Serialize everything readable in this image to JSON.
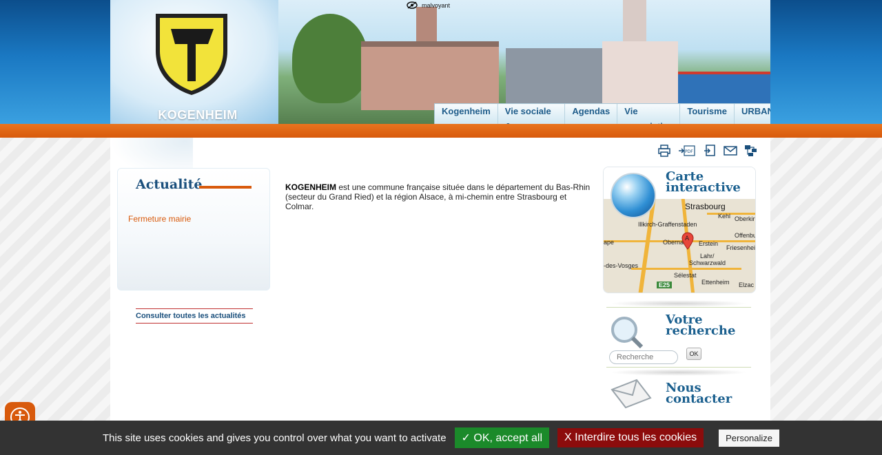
{
  "header": {
    "site_name": "KOGENHEIM",
    "accessibility_link": "malvoyant"
  },
  "nav": {
    "items": [
      {
        "label": "Kogenheim"
      },
      {
        "label": "Vie sociale & économique"
      },
      {
        "label": "Agendas"
      },
      {
        "label": "Vie associative"
      },
      {
        "label": "Tourisme"
      },
      {
        "label": "URBANISME"
      }
    ]
  },
  "tools": [
    "print-icon",
    "pdf-icon",
    "export-icon",
    "mail-icon",
    "sitemap-icon"
  ],
  "news": {
    "title": "Actualité",
    "items": [
      "Fermeture mairie"
    ],
    "all_link": "Consulter toutes les actualités"
  },
  "intro": {
    "strong": "KOGENHEIM",
    "text": " est une commune française située dans le département du Bas-Rhin (secteur du Grand Ried) et la région Alsace, à mi-chemin entre Strasbourg et Colmar."
  },
  "map": {
    "title_line1": "Carte",
    "title_line2": "interactive",
    "labels": {
      "strasbourg": "Strasbourg",
      "kehl": "Kehl",
      "illkirch": "Illkirch-Graffenstaden",
      "oberkirch": "Oberkir",
      "offenburg": "Offenbu",
      "obernai": "Oberna",
      "erstein": "Erstein",
      "friesenheim": "Friesenhei",
      "lahr": "Lahr/",
      "schwarzwald": "Schwarzwald",
      "sainte": "-des-Vosges",
      "ape": "ape",
      "selestat": "Sélestat",
      "ettenheim": "Ettenheim",
      "elzach": "Elzac",
      "pin_letter": "A",
      "road": "E25"
    }
  },
  "search": {
    "title_line1": "Votre",
    "title_line2": "recherche",
    "placeholder": "Recherche",
    "button": "OK"
  },
  "contact": {
    "title_line1": "Nous",
    "title_line2": "contacter"
  },
  "cookies": {
    "message": "This site uses cookies and gives you control over what you want to activate",
    "accept": "✓ OK, accept all",
    "deny": "X Interdire tous les cookies",
    "customize": "Personalize"
  },
  "colors": {
    "primary_blue": "#1a78c2",
    "accent_orange": "#d85a0c",
    "title_blue": "#1a5f8e",
    "cookie_bg": "#333333",
    "accept_green": "#1b8a2a",
    "deny_red": "#8c0c0c"
  }
}
